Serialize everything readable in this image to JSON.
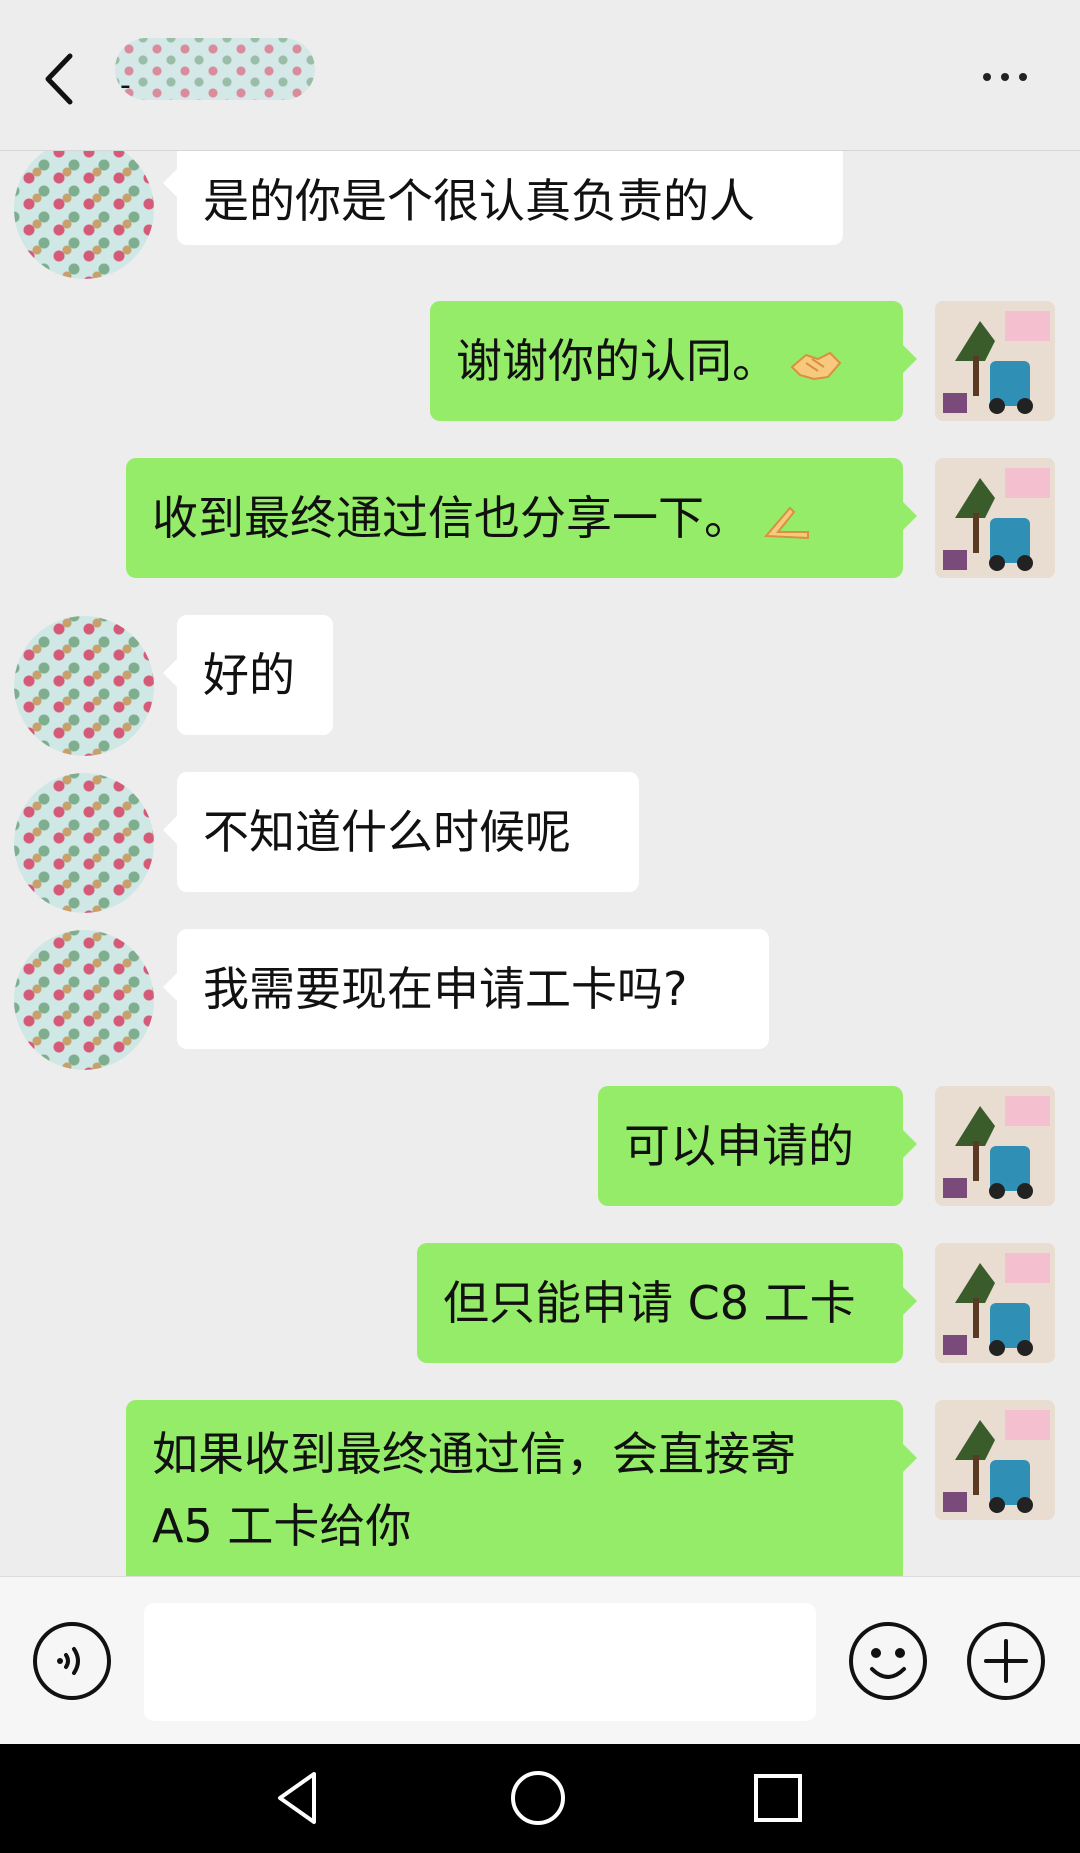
{
  "header": {
    "title_visible": "-",
    "back_icon": "chevron-left-icon",
    "more_icon": "more-dots-icon"
  },
  "messages": [
    {
      "side": "in",
      "text": "是的你是个很认真负责的人"
    },
    {
      "side": "out",
      "text": "谢谢你的认同。",
      "emoji": "handshake"
    },
    {
      "side": "out",
      "text": "收到最终通过信也分享一下。",
      "emoji": "pinched-fingers"
    },
    {
      "side": "in",
      "text": "好的"
    },
    {
      "side": "in",
      "text": "不知道什么时候呢"
    },
    {
      "side": "in",
      "text": "我需要现在申请工卡吗?"
    },
    {
      "side": "out",
      "text": "可以申请的"
    },
    {
      "side": "out",
      "text": "但只能申请 C8 工卡"
    },
    {
      "side": "out",
      "text_line1": "如果收到最终通过信，会直接寄",
      "text_line2": "A5 工卡给你"
    }
  ],
  "input_bar": {
    "placeholder": "",
    "value": "",
    "voice_icon": "voice-icon",
    "emoji_icon": "emoji-icon",
    "plus_icon": "plus-icon"
  },
  "colors": {
    "background": "#ededed",
    "outgoing_bubble": "#95ec69",
    "incoming_bubble": "#ffffff"
  }
}
